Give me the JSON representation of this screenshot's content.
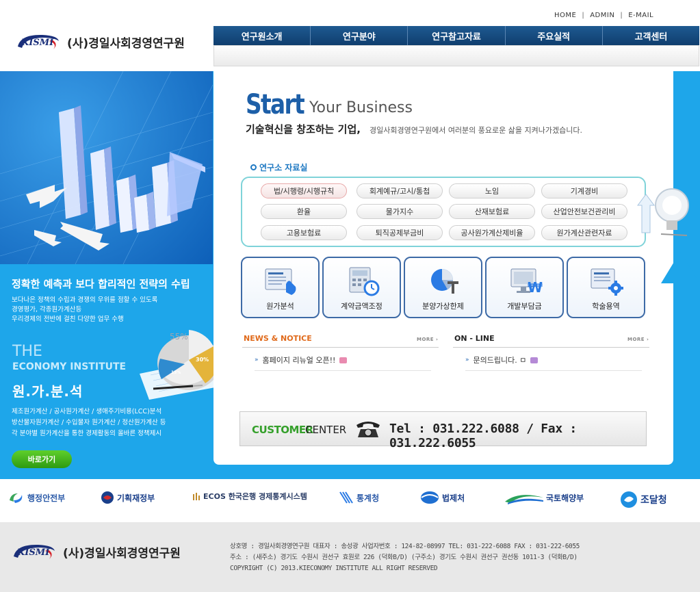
{
  "top_links": [
    "HOME",
    "ADMIN",
    "E-MAIL"
  ],
  "logo": {
    "mark": "KISMI",
    "org": "(사)경일사회경영연구원"
  },
  "gnb": [
    "연구원소개",
    "연구분야",
    "연구참고자료",
    "주요실적",
    "고객센터"
  ],
  "hero": {
    "start": "Start",
    "your_business": "Your Business",
    "tagline": "기술혁신을 창조하는 기업,",
    "tagline_sub": "경일사회경영연구원에서 여러분의 풍요로운 삶을 지켜나가겠습니다."
  },
  "side": {
    "headline": "정확한 예측과 보다 합리적인 전략의 수립",
    "lines": [
      "보다나은 정책의 수립과 경쟁의 우위를 점할 수 있도록",
      "경영평가, 각종원가계산등",
      "우리경제의 전반에 걸친 다양한 업무 수행"
    ],
    "the": "THE",
    "economy": "ECONOMY INSTITUTE",
    "wonga": "원.가.분.석",
    "lines2": [
      "제조원가계산 / 공사원가계산 / 생애주기비용(LCC)분석",
      "방산물자원가계산 / 수입물자 원가계산 / 정산원가계산 등",
      "각 분야별 원가계산을 통한 경제활동의 올바른 정책제시"
    ],
    "go_button": "바로가기",
    "pie_labels": [
      "55%",
      "30%",
      "15%"
    ]
  },
  "reference": {
    "title": "연구소 자료실",
    "items": [
      [
        "법/시행령/시행규칙",
        "회계예규/고시/통첩",
        "노임",
        "기계경비"
      ],
      [
        "환율",
        "물가지수",
        "산재보험료",
        "산업안전보건관리비"
      ],
      [
        "고용보험료",
        "퇴직공제부금비",
        "공사원가계산제비율",
        "원가계산관련자료"
      ]
    ]
  },
  "services": [
    {
      "label": "원가분석",
      "icon": "document-hand-icon"
    },
    {
      "label": "계약금액조정",
      "icon": "calculator-clock-icon"
    },
    {
      "label": "분양가상한제",
      "icon": "pie-chart-icon"
    },
    {
      "label": "개발부담금",
      "icon": "monitor-won-icon"
    },
    {
      "label": "학술용역",
      "icon": "document-gear-icon"
    }
  ],
  "news": {
    "title": "NEWS & NOTICE",
    "more": "MORE ›",
    "post": "홈페이지 리뉴얼 오픈!!"
  },
  "online": {
    "title": "ON - LINE",
    "more": "MORE ›",
    "post": "문의드립니다. ㅁ"
  },
  "customer": {
    "label1": "CUSTOMER",
    "label2": "CENTER",
    "tel": "Tel : 031.222.6088 / Fax : 031.222.6055"
  },
  "partners": [
    "행정안전부",
    "기획재정부",
    "ECOS 한국은행 경제통계시스템",
    "통계청",
    "법제처",
    "국토해양부",
    "조달청"
  ],
  "footer": {
    "lines": [
      "상호명 : 경일사회경영연구원   대표자 : 송성광   사업자번호 : 124-82-08997   TEL: 031-222-6088   FAX : 031-222-6055",
      "주소 : (새주소) 경기도 수원시 권선구 효원로 226 (덕화B/D)   (구주소) 경기도 수원시 권선구 권선동 1011-3 (덕화B/D)",
      "COPYRIGHT (C) 2013.KIECONOMY INSTITUTE ALL RIGHT RESERVED"
    ]
  },
  "colors": {
    "nav": "#1e5a91",
    "accent_blue": "#1ea6ea",
    "customer_green": "#35a02b",
    "news_orange": "#e06a1b"
  }
}
